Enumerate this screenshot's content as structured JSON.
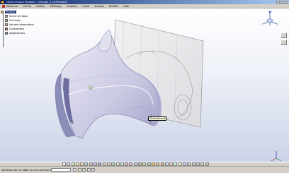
{
  "window": {
    "title": "CATIA V5 pour étudiant - [rescope_1.CATProduct]"
  },
  "menu": {
    "items": [
      "Démarrer",
      "Fichier",
      "Edition",
      "Affichage",
      "Insertion",
      "Outils",
      "Analyse",
      "Fenêtre",
      "Aide"
    ]
  },
  "tree": {
    "root": "Product",
    "children": [
      "Struct de base",
      "Car body",
      "Volume réservation",
      "Contraintes",
      "Applications"
    ]
  },
  "viewport": {
    "tooltip": "Déroulement"
  },
  "compass": {
    "x_label": "x",
    "y_label": "y",
    "z_label": "z"
  },
  "status": {
    "message": "Sélectionner un objet ou une commande"
  },
  "colors": {
    "title_start": "#0a246a",
    "title_end": "#a6caf0",
    "selection": "#0a246a",
    "body_light": "#e6e6f2",
    "body_shade": "#a6a6cc"
  }
}
